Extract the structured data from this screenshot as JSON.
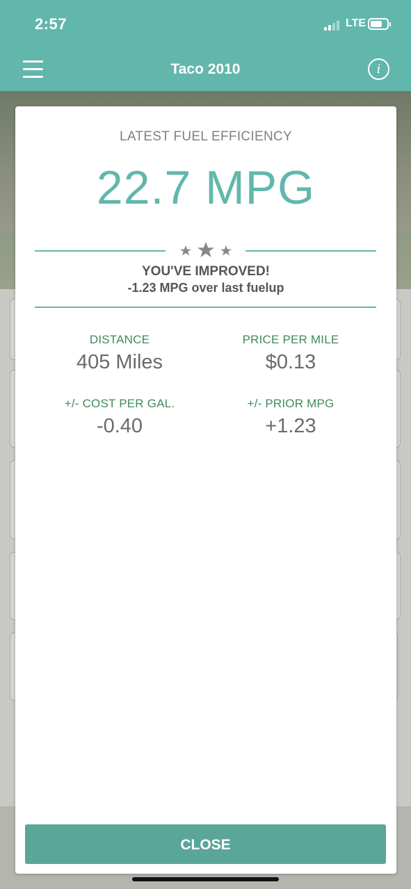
{
  "status_bar": {
    "time": "2:57",
    "network": "LTE"
  },
  "nav": {
    "title": "Taco 2010",
    "menu_icon": "hamburger-menu-icon",
    "info_icon": "info-circle-icon",
    "info_glyph": "i"
  },
  "modal": {
    "heading": "LATEST FUEL EFFICIENCY",
    "mpg": "22.7 MPG",
    "rating_icon": "three-stars-icon",
    "improved_title": "YOU'VE IMPROVED!",
    "improved_subtitle": "-1.23 MPG over last fuelup",
    "stats": [
      {
        "label": "DISTANCE",
        "value": "405 Miles"
      },
      {
        "label": "PRICE PER MILE",
        "value": "$0.13"
      },
      {
        "label": "+/- COST PER GAL.",
        "value": "-0.40"
      },
      {
        "label": "+/- PRIOR MPG",
        "value": "+1.23"
      }
    ],
    "close_label": "CLOSE"
  },
  "colors": {
    "accent": "#62b7ac",
    "button": "#5aa698",
    "label_green": "#3f8a5f"
  }
}
